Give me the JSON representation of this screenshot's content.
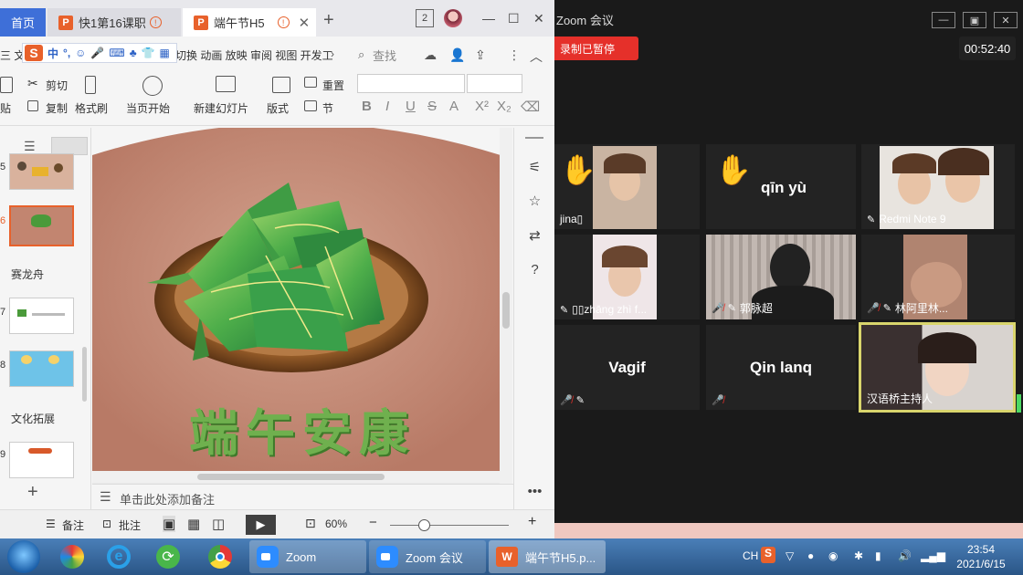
{
  "wps": {
    "tabs": {
      "home": "首页",
      "doc1": "快1第16课职",
      "doc2": "端午节H5",
      "app_badge": "P",
      "window_count": "2"
    },
    "ime": {
      "logo": "S",
      "lang": "中"
    },
    "menu": {
      "file": "三 文",
      "items_right": "切换 动画 放映 审阅 视图 开发工",
      "search": "查找"
    },
    "ribbon": {
      "paste": "贴",
      "cut": "剪切",
      "copy": "复制",
      "format_painter": "格式刷",
      "from_current": "当页开始",
      "new_slide": "新建幻灯片",
      "layout": "版式",
      "reset": "重置",
      "section": "节"
    },
    "thumbs": {
      "n5": "5",
      "n6": "6",
      "n7": "7",
      "n8": "8",
      "n9": "9",
      "section_dragon": "赛龙舟",
      "section_culture": "文化拓展"
    },
    "slide": {
      "title": "端午安康"
    },
    "notes_placeholder": "单击此处添加备注",
    "status": {
      "notes": "备注",
      "comments": "批注",
      "zoom": "60%"
    }
  },
  "zoom": {
    "title": "Zoom 会议",
    "recording": "录制已暂停",
    "timer": "00:52:40",
    "participants": {
      "p1": "jina▯",
      "p2": "qīn yù",
      "p3": "Redmi Note 9",
      "p4": "▯▯zhāng zhì f...",
      "p5": "郭脉超",
      "p6": "林阿里林...",
      "p7": "Vagif",
      "p8": "Qin lanq",
      "p9": "汉语桥主持人"
    }
  },
  "taskbar": {
    "task_zoom": "Zoom",
    "task_zoom_meeting": "Zoom 会议",
    "task_wps": "端午节H5.p...",
    "lang": "CH",
    "time": "23:54",
    "date": "2021/6/15"
  }
}
